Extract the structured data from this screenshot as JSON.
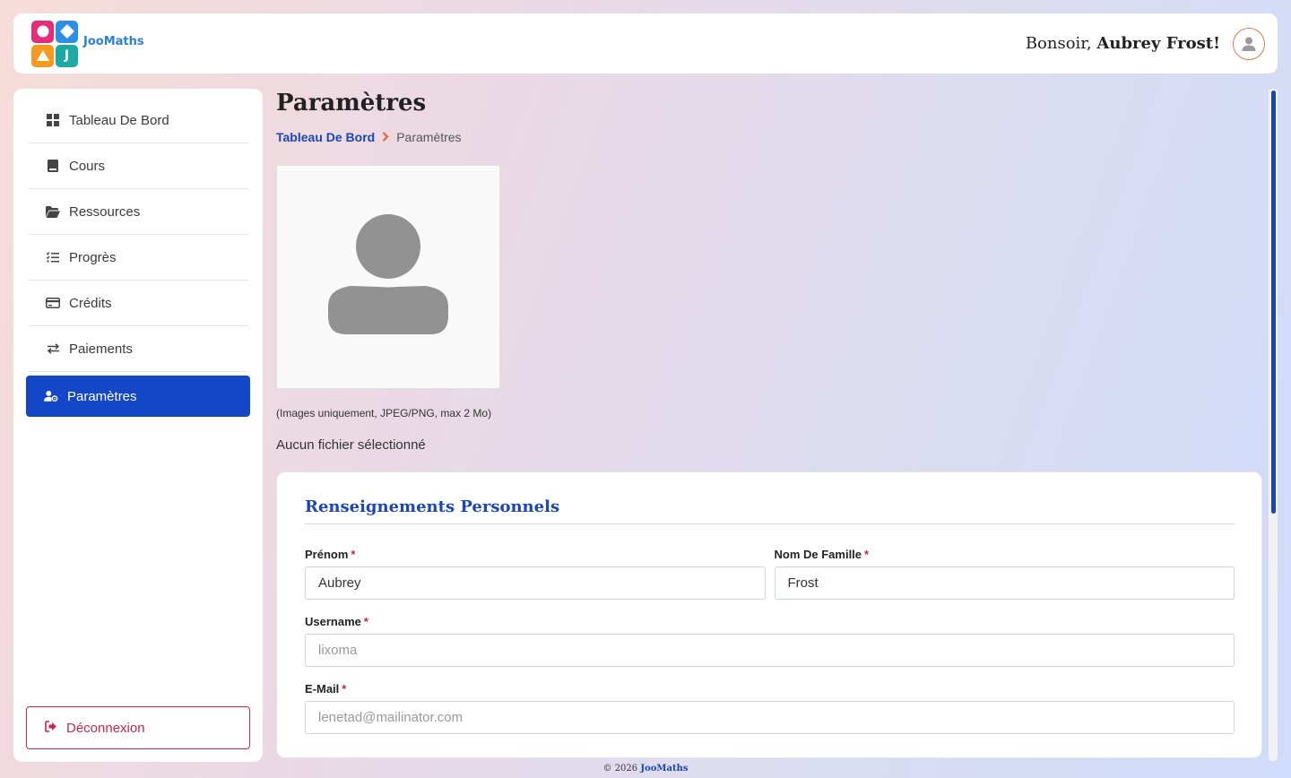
{
  "header": {
    "brand": "JooMaths",
    "logo_letter": "J",
    "greeting_prefix": "Bonsoir,",
    "user_name": "Aubrey Frost!"
  },
  "sidebar": {
    "items": [
      {
        "label": "Tableau De Bord",
        "icon": "dashboard-icon"
      },
      {
        "label": "Cours",
        "icon": "book-icon"
      },
      {
        "label": "Ressources",
        "icon": "folder-open-icon"
      },
      {
        "label": "Progrès",
        "icon": "list-check-icon"
      },
      {
        "label": "Crédits",
        "icon": "credit-card-icon"
      },
      {
        "label": "Paiements",
        "icon": "exchange-icon"
      },
      {
        "label": "Paramètres",
        "icon": "user-gear-icon",
        "active": true
      }
    ],
    "logout_label": "Déconnexion"
  },
  "page": {
    "title": "Paramètres",
    "breadcrumb": {
      "home": "Tableau De Bord",
      "current": "Paramètres"
    },
    "photo_hint": "(Images uniquement, JPEG/PNG, max 2 Mo)",
    "file_status": "Aucun fichier sélectionné"
  },
  "form": {
    "section_title": "Renseignements Personnels",
    "required_mark": "*",
    "first_name": {
      "label": "Prénom",
      "value": "Aubrey"
    },
    "last_name": {
      "label": "Nom De Famille",
      "value": "Frost"
    },
    "username": {
      "label": "Username",
      "placeholder": "lixoma"
    },
    "email": {
      "label": "E-Mail",
      "placeholder": "lenetad@mailinator.com"
    }
  },
  "footer": {
    "copyright": "© 2026",
    "brand": "JooMaths"
  },
  "colors": {
    "accent": "#1446c8",
    "danger": "#c7254e",
    "logo_pink": "#e82a7a",
    "logo_blue": "#2d8ee6",
    "logo_orange": "#f59a1e",
    "logo_teal": "#1eaaa4"
  }
}
